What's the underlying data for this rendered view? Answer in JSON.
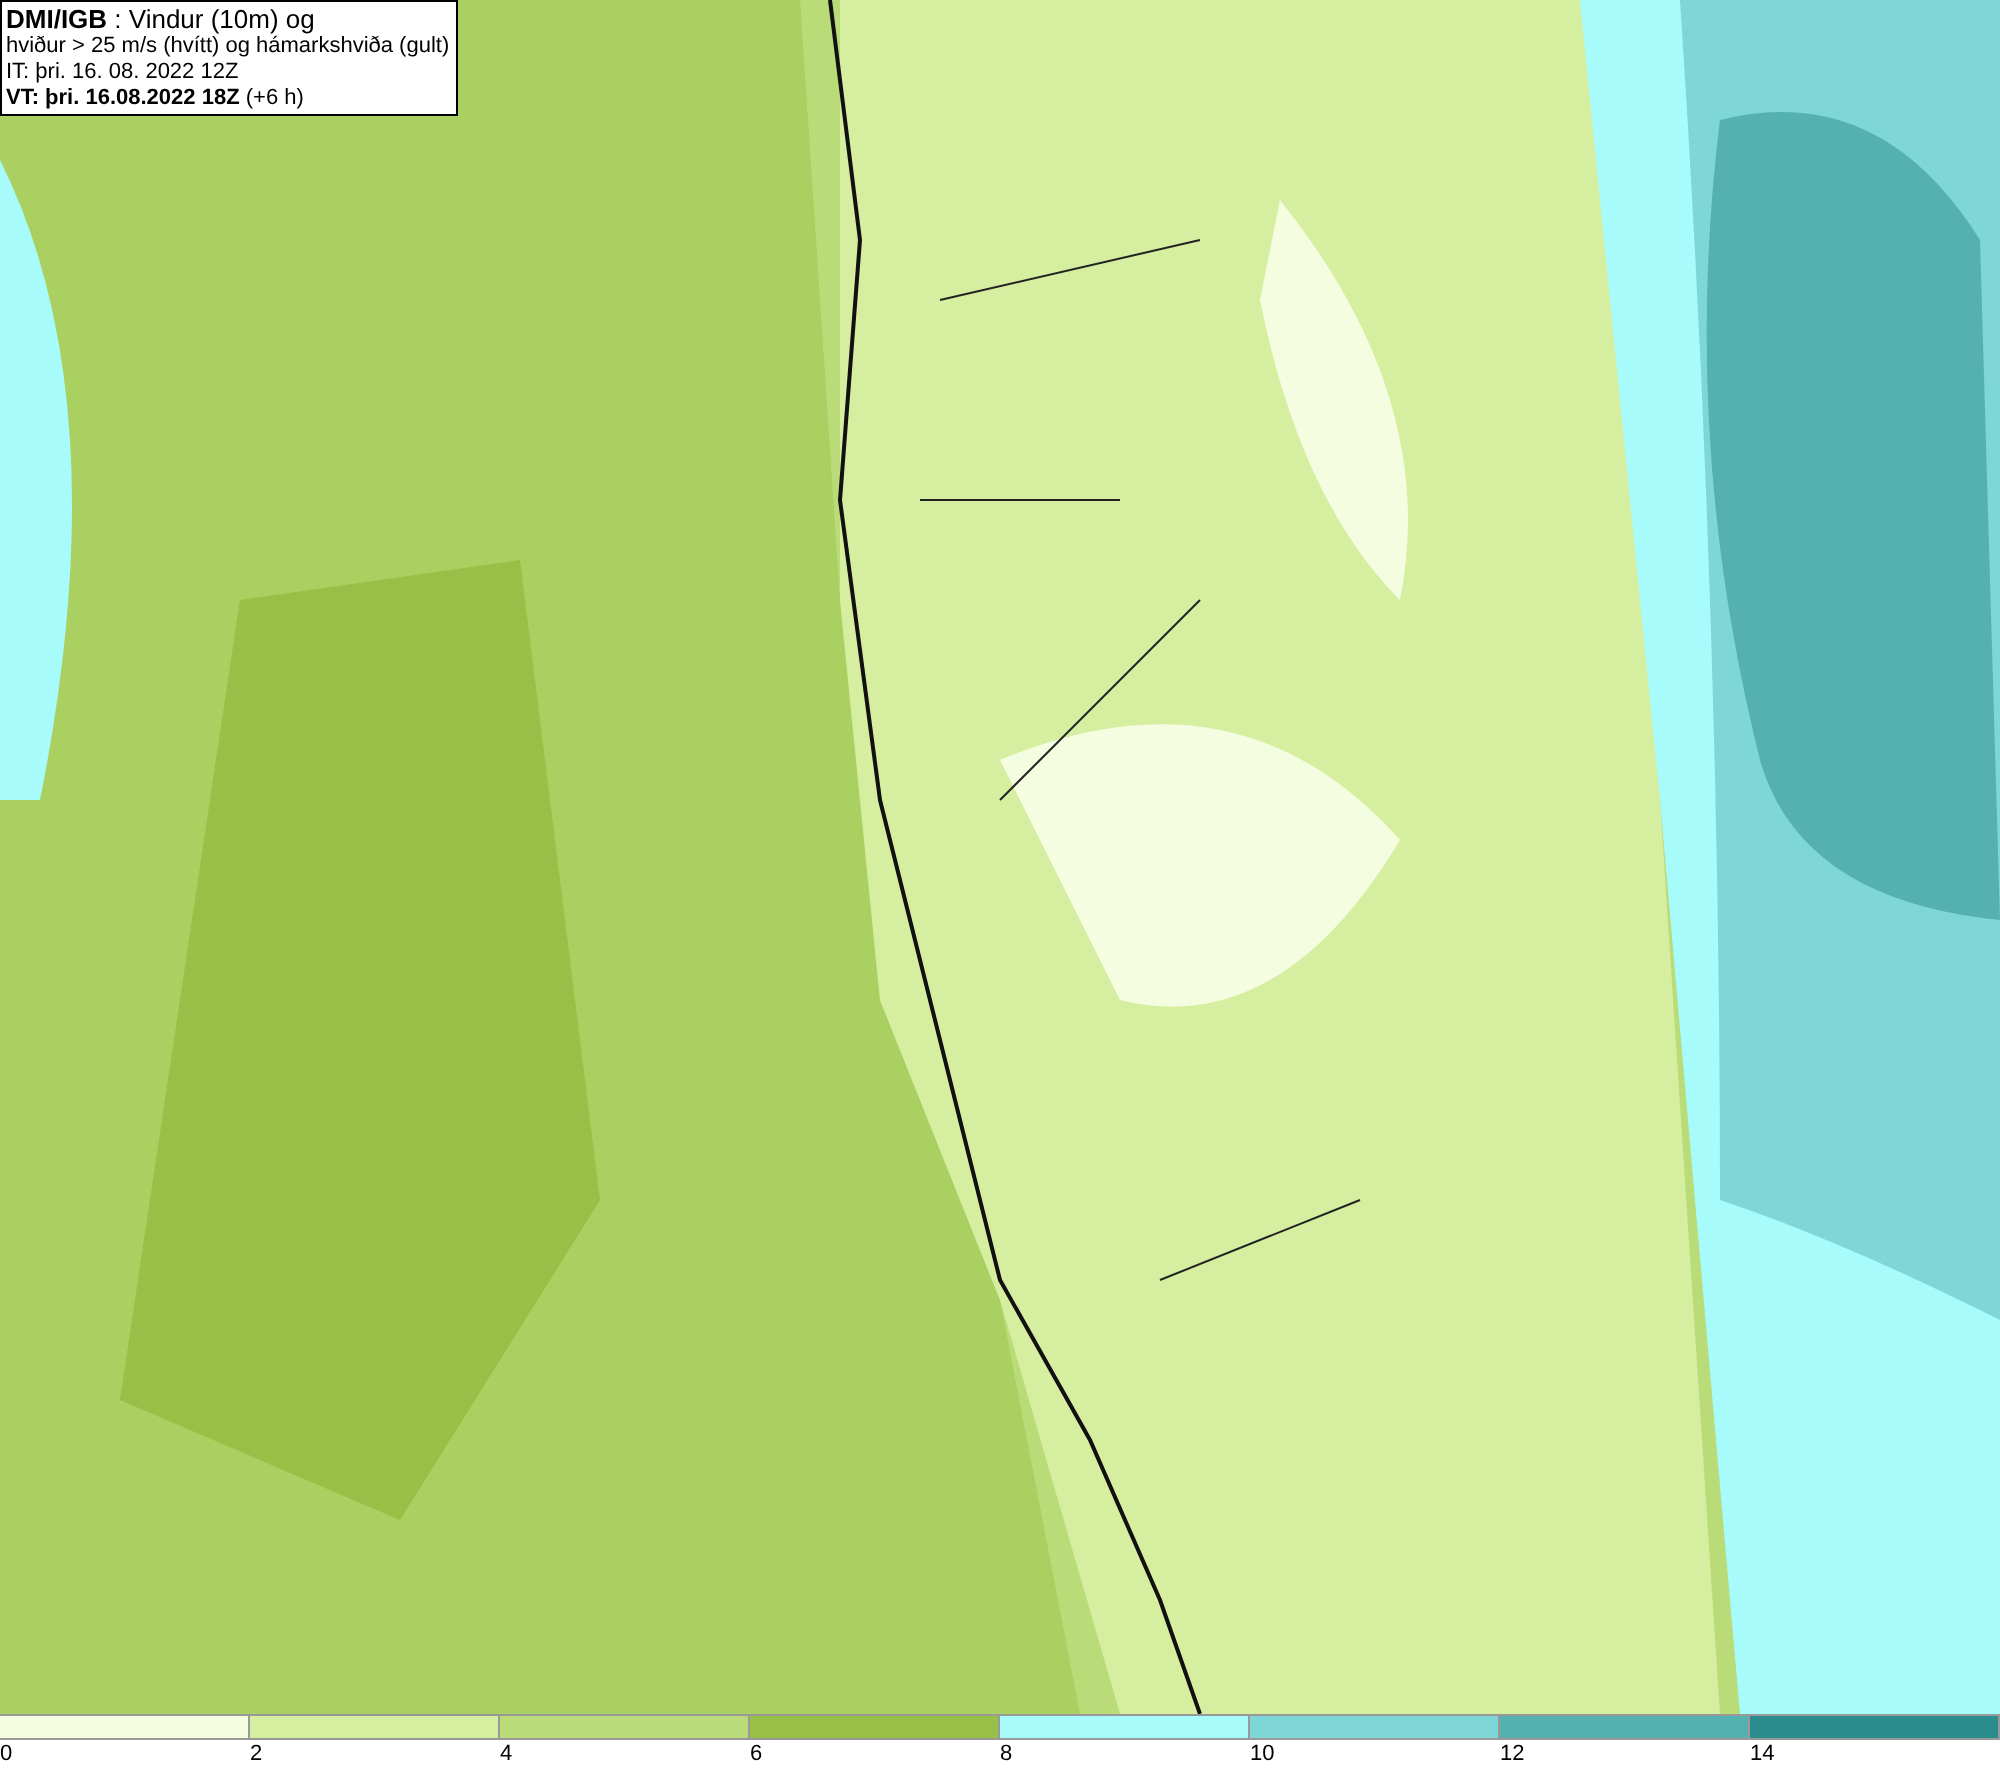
{
  "title_box": {
    "lines": [
      "**DMI/IGB** : Vindur (10m) og",
      "hviður > 25 m/s (hvítt) og hámarkshviða (gult)",
      "IT: þri. 16. 08. 2022 12Z",
      "**VT: þri. 16.08.2022 18Z** (+6 h)"
    ]
  },
  "legend": {
    "items": [
      {
        "label": "0",
        "color": "#f5fde0"
      },
      {
        "label": "2",
        "color": "#d6eea0"
      },
      {
        "label": "4",
        "color": "#b9dc78"
      },
      {
        "label": "6",
        "color": "#98c046"
      },
      {
        "label": "8",
        "color": "#a8fbfb"
      },
      {
        "label": "10",
        "color": "#7fd6d6"
      },
      {
        "label": "12",
        "color": "#55b0b0"
      },
      {
        "label": "14",
        "color": "#2a8c8c"
      }
    ]
  }
}
